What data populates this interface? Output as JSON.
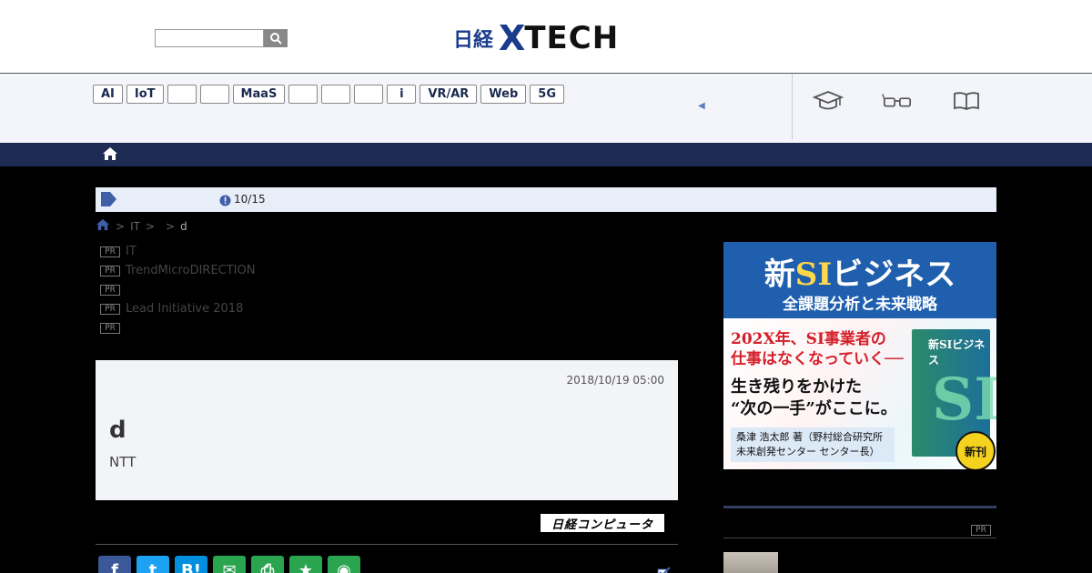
{
  "header": {
    "search_placeholder": "",
    "logo_nikkei": "日経",
    "logo_x": "X",
    "logo_tech": "TECH"
  },
  "tagnav": {
    "tags": [
      "AI",
      "IoT",
      "",
      "",
      "MaaS",
      "",
      "",
      "",
      "i",
      "VR/AR",
      "Web",
      "5G"
    ],
    "icons": [
      "graduation-cap-icon",
      "glasses-icon",
      "book-icon"
    ]
  },
  "notice": {
    "date": "10/15"
  },
  "breadcrumb": {
    "items": [
      "IT",
      ""
    ],
    "last": "d",
    "separator": ">"
  },
  "pr_list": {
    "badge": "PR",
    "items": [
      "IT",
      "TrendMicroDIRECTION",
      "",
      "Lead Initiative 2018",
      ""
    ]
  },
  "article": {
    "date": "2018/10/19 05:00",
    "title": "d",
    "subtitle": "NTT",
    "source": "日経コンピュータ"
  },
  "share": {
    "buttons": [
      {
        "name": "facebook",
        "label": "f",
        "color": "#3b5998"
      },
      {
        "name": "twitter",
        "label": "t",
        "color": "#1da1f2"
      },
      {
        "name": "hatena",
        "label": "B!",
        "color": "#008fde"
      },
      {
        "name": "mail",
        "label": "✉",
        "color": "#2aa44f"
      },
      {
        "name": "print",
        "label": "⎙",
        "color": "#2aa44f"
      },
      {
        "name": "favorite",
        "label": "★",
        "color": "#2aa44f"
      },
      {
        "name": "view",
        "label": "◉",
        "color": "#2aa44f"
      }
    ]
  },
  "ad": {
    "title_new": "新",
    "title_si": "SI",
    "title_rest": "ビジネス",
    "subtitle": "全課題分析と未来戦略",
    "line1a": "202X年、SI事業者の",
    "line1b": "仕事はなくなっていく──",
    "line2a": "生き残りをかけた",
    "line2b": "“次の一手”がここに。",
    "author1": "桑津 浩太郎 著（野村総合研究所",
    "author2": "未来創発センター センター長）",
    "book_title": "新SIビジネス",
    "book_si": "SI",
    "new_badge": "新刊"
  },
  "sidebar": {
    "pr_badge": "PR"
  },
  "colors": {
    "brand": "#1a3c8c",
    "homebar": "#1e2c55",
    "notice_bg": "#e8eef8"
  }
}
